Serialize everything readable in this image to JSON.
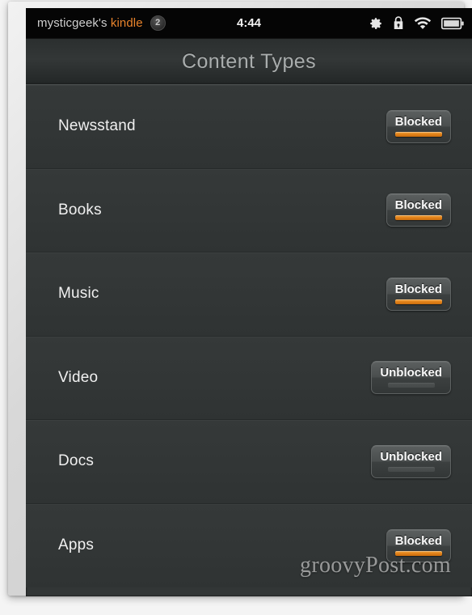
{
  "status_bar": {
    "device_owner": "mysticgeek's",
    "device_brand": "kindle",
    "notification_count": "2",
    "time": "4:44",
    "icons": [
      "gear-icon",
      "lock-icon",
      "wifi-icon",
      "battery-icon"
    ]
  },
  "header": {
    "title": "Content Types"
  },
  "content_types": {
    "rows": [
      {
        "label": "Newsstand",
        "state": "Blocked",
        "state_key": "blocked"
      },
      {
        "label": "Books",
        "state": "Blocked",
        "state_key": "blocked"
      },
      {
        "label": "Music",
        "state": "Blocked",
        "state_key": "blocked"
      },
      {
        "label": "Video",
        "state": "Unblocked",
        "state_key": "unblocked"
      },
      {
        "label": "Docs",
        "state": "Unblocked",
        "state_key": "unblocked"
      },
      {
        "label": "Apps",
        "state": "Blocked",
        "state_key": "blocked"
      }
    ]
  },
  "watermark": {
    "text": "groovyPost.com"
  },
  "colors": {
    "brand_orange": "#e8832c",
    "blocked_bar": "#e07f18",
    "unblocked_bar": "#4a4e4e",
    "screen_background": "#323636",
    "status_bar_background": "#050505",
    "title_text": "#a9adad"
  }
}
